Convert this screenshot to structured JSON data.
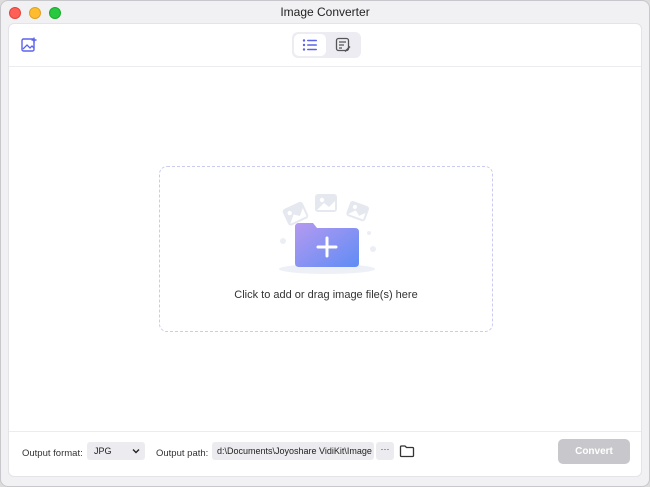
{
  "window": {
    "title": "Image Converter"
  },
  "toolbar": {
    "add_icon": "add-image-icon",
    "view_list_icon": "list-icon",
    "view_edit_icon": "edit-list-icon"
  },
  "dropzone": {
    "text": "Click to add or drag image file(s) here"
  },
  "footer": {
    "format_label": "Output format:",
    "format_value": "JPG",
    "path_label": "Output path:",
    "path_value": "d:\\Documents\\Joyoshare VidiKit\\Image",
    "more_label": "···",
    "convert_label": "Convert"
  },
  "colors": {
    "accent": "#5b63e8",
    "disabled_button": "#c8c8cc"
  }
}
